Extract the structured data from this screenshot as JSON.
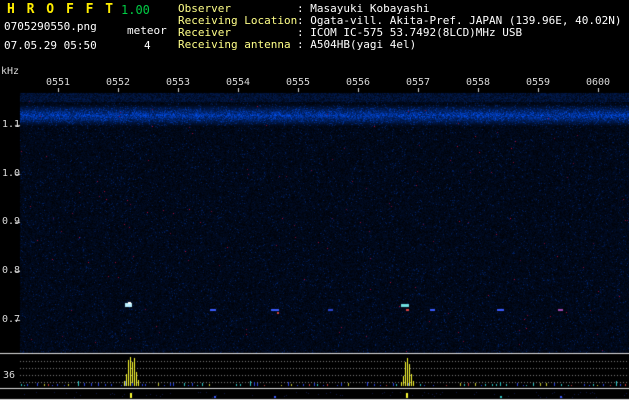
{
  "header": {
    "app_title": "H R O F F T",
    "version": "1.00",
    "filename": "0705290550.png",
    "mode_label": "meteor",
    "datetime": "07.05.29 05:50",
    "count": "4",
    "info_rows": [
      {
        "label": "Observer",
        "value": ": Masayuki Kobayashi"
      },
      {
        "label": "Receiving Location",
        "value": ": Ogata-vill. Akita-Pref. JAPAN (139.96E, 40.02N)"
      },
      {
        "label": "Receiver",
        "value": ": ICOM IC-575 53.7492(8LCD)MHz USB"
      },
      {
        "label": "Receiving antenna",
        "value": ": A504HB(yagi 4el)"
      }
    ]
  },
  "colors": {
    "title_yellow": "#ffee00",
    "version_green": "#00cc44",
    "info_label": "#ffff88",
    "info_value": "#ffffff",
    "axis_text": "#d8d8d8",
    "spike_yellow": "#ffff33",
    "band_blue": "#2233bb"
  },
  "chart_data": {
    "type": "heatmap",
    "x_axis": {
      "tick_labels": [
        "0551",
        "0552",
        "0553",
        "0554",
        "0555",
        "0556",
        "0557",
        "0558",
        "0559",
        "0600"
      ]
    },
    "y_axis": {
      "unit": "kHz",
      "tick_labels": [
        "1.1",
        "1.0",
        "0.9",
        "0.8",
        "0.7"
      ],
      "tick_values": [
        1.1,
        1.0,
        0.9,
        0.8,
        0.7
      ]
    },
    "carrier_band": {
      "center_khz": 1.12,
      "width_khz": 0.04
    },
    "echoes": [
      {
        "minute": 2.17,
        "khz": 0.73,
        "color": "#baf0ff",
        "w": 7,
        "h": 4
      },
      {
        "minute": 2.19,
        "khz": 0.735,
        "color": "#ffffff",
        "w": 3,
        "h": 2
      },
      {
        "minute": 3.58,
        "khz": 0.72,
        "color": "#3a5bff",
        "w": 6,
        "h": 2
      },
      {
        "minute": 4.62,
        "khz": 0.72,
        "color": "#3a5bff",
        "w": 8,
        "h": 2
      },
      {
        "minute": 4.66,
        "khz": 0.715,
        "color": "#cc4444",
        "w": 2,
        "h": 2
      },
      {
        "minute": 5.53,
        "khz": 0.72,
        "color": "#2a44cc",
        "w": 5,
        "h": 2
      },
      {
        "minute": 6.78,
        "khz": 0.73,
        "color": "#6fe0e0",
        "w": 8,
        "h": 3
      },
      {
        "minute": 6.82,
        "khz": 0.72,
        "color": "#dd4444",
        "w": 3,
        "h": 2
      },
      {
        "minute": 7.23,
        "khz": 0.72,
        "color": "#3a5bff",
        "w": 5,
        "h": 2
      },
      {
        "minute": 8.37,
        "khz": 0.72,
        "color": "#3a5bff",
        "w": 7,
        "h": 2
      },
      {
        "minute": 9.37,
        "khz": 0.72,
        "color": "#a04ab0",
        "w": 5,
        "h": 2
      }
    ],
    "bottom_panel": {
      "left_label": "36",
      "gridline_ys": [
        361,
        368,
        375,
        382
      ],
      "spike_clusters": [
        {
          "minute": 2.2,
          "heights": [
            5,
            12,
            26,
            29,
            24,
            28,
            14,
            6
          ]
        },
        {
          "minute": 6.8,
          "heights": [
            4,
            10,
            24,
            28,
            22,
            12,
            5
          ]
        }
      ]
    },
    "strip_ticks": [
      {
        "minute": 2.2,
        "color": "#ffff33",
        "h": 5
      },
      {
        "minute": 6.8,
        "color": "#ffff33",
        "h": 5
      },
      {
        "minute": 3.6,
        "color": "#3a5bff",
        "h": 2
      },
      {
        "minute": 4.6,
        "color": "#3a5bff",
        "h": 2
      },
      {
        "minute": 8.37,
        "color": "#2ec9c9",
        "h": 2
      },
      {
        "minute": 9.37,
        "color": "#3a5bff",
        "h": 2
      }
    ]
  }
}
